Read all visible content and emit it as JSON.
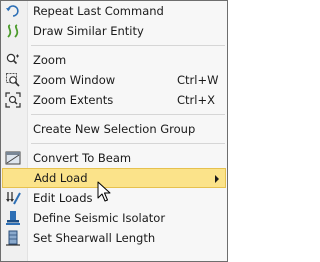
{
  "menu": {
    "items": [
      {
        "label": "Repeat Last Command",
        "icon": "repeat-icon"
      },
      {
        "label": "Draw Similar Entity",
        "icon": "draw-similar-icon"
      },
      {
        "label": "Zoom",
        "icon": "zoom-icon"
      },
      {
        "label": "Zoom Window",
        "shortcut": "Ctrl+W",
        "icon": "zoom-window-icon"
      },
      {
        "label": "Zoom Extents",
        "shortcut": "Ctrl+X",
        "icon": "zoom-extents-icon"
      },
      {
        "label": "Create New Selection Group"
      },
      {
        "label": "Convert To Beam",
        "icon": "convert-beam-icon"
      },
      {
        "label": "Add Load",
        "has_submenu": true
      },
      {
        "label": "Edit Loads",
        "icon": "edit-loads-icon"
      },
      {
        "label": "Define Seismic Isolator",
        "icon": "seismic-isolator-icon"
      },
      {
        "label": "Set Shearwall Length",
        "icon": "shearwall-icon"
      }
    ]
  },
  "colors": {
    "highlight": "#fbe38a",
    "highlight_border": "#e6c14f",
    "icon_blue": "#2d6fb5",
    "icon_green": "#4a9a2a"
  }
}
